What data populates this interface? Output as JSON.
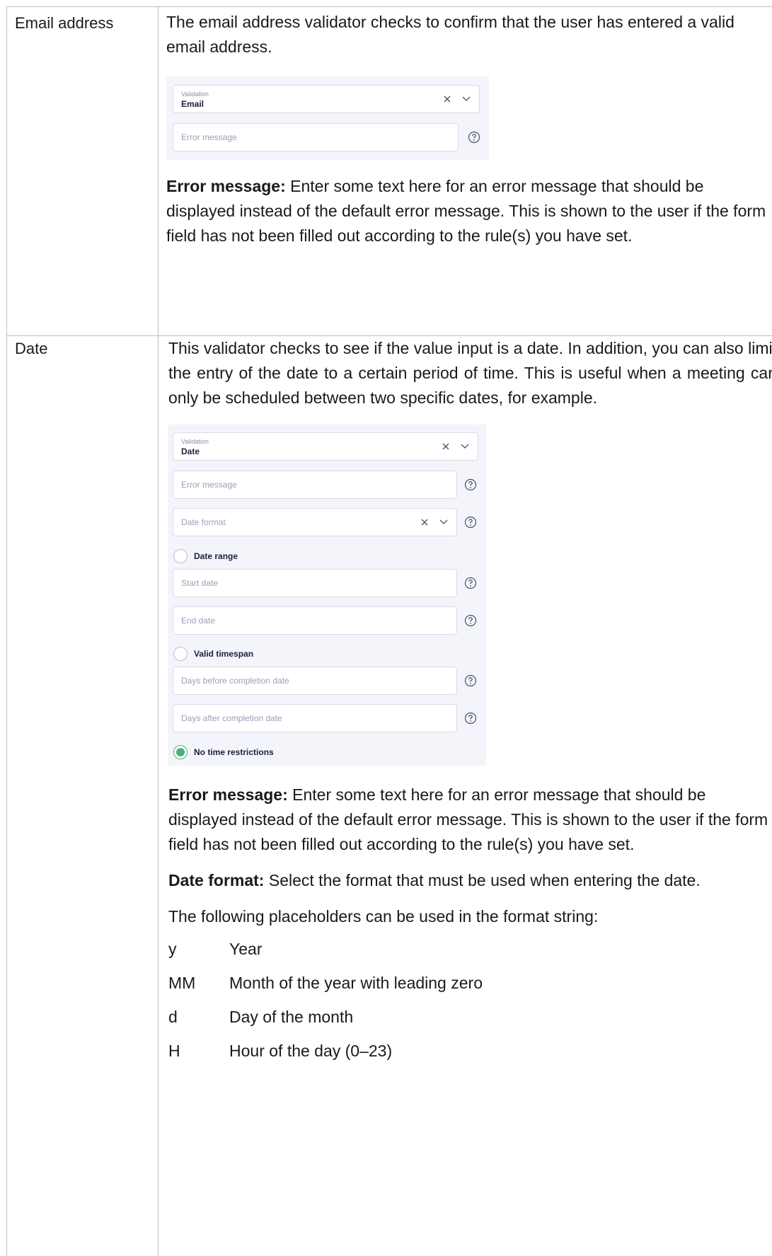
{
  "rows": [
    {
      "label": "Email address",
      "intro": "The email address validator checks to confirm that the user has entered a valid email address.",
      "mock": {
        "validation_label": "Validation",
        "validation_value": "Email",
        "error_placeholder": "Error message"
      },
      "note_bold": "Error message:",
      "note_text": " Enter some text here for an error message that should be displayed instead of the default error message. This is shown to the user if the form field has not been filled out according to the rule(s) you have set."
    },
    {
      "label": "Date",
      "intro": "This validator checks to see if the value input is a date. In addition, you can also limit the entry of the date to a certain period of time. This is useful when a meeting can only be scheduled between two specific dates, for example.",
      "mock": {
        "validation_label": "Validation",
        "validation_value": "Date",
        "error_placeholder": "Error message",
        "date_format_placeholder": "Date format",
        "date_range_label": "Date range",
        "start_date_placeholder": "Start date",
        "end_date_placeholder": "End date",
        "valid_timespan_label": "Valid timespan",
        "days_before_placeholder": "Days before completion date",
        "days_after_placeholder": "Days after completion date",
        "no_restrictions_label": "No time restrictions"
      },
      "note_bold": "Error message:",
      "note_text": "  Enter some text here for an error message that should be displayed instead of the default error message. This is shown to the user if the form field has not been filled out according to the rule(s) you have set.",
      "format_bold": "Date format:",
      "format_text": "  Select the format that must be used when entering the date.",
      "placeholders_intro": "The following placeholders can be used in the format string:",
      "placeholders": [
        {
          "key": "y",
          "desc": "Year"
        },
        {
          "key": "MM",
          "desc": "Month of the year with leading zero"
        },
        {
          "key": "d",
          "desc": "Day of the month"
        },
        {
          "key": "H",
          "desc": "Hour of the day (0–23)"
        }
      ]
    }
  ],
  "colors": {
    "panel_bg": "#f4f5fa",
    "field_border": "#d9dbe6",
    "radio_selected": "#4ab07a",
    "table_border": "#bdbdbd"
  }
}
